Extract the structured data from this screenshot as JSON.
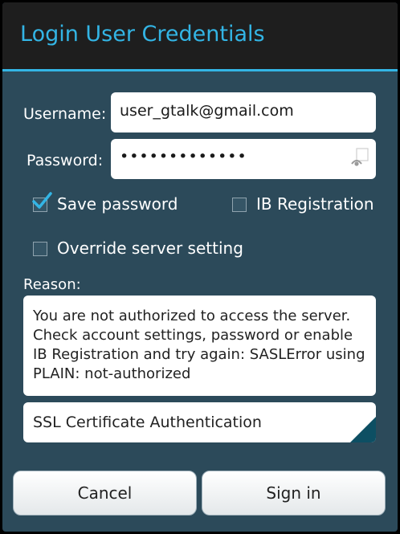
{
  "dialog": {
    "title": "Login User Credentials"
  },
  "form": {
    "username_label": "Username:",
    "username_value": "user_gtalk@gmail.com",
    "password_label": "Password:",
    "password_masked": "•••••••••••••"
  },
  "options": {
    "save_password_label": "Save password",
    "save_password_checked": true,
    "ib_registration_label": "IB Registration",
    "ib_registration_checked": false,
    "override_server_label": "Override server setting",
    "override_server_checked": false
  },
  "reason": {
    "label": "Reason:",
    "text": "You are not authorized to access the server. Check account settings, password or enable IB Registration and try again: SASLError using PLAIN: not-authorized"
  },
  "auth_select": {
    "selected": "SSL Certificate Authentication"
  },
  "buttons": {
    "cancel": "Cancel",
    "sign_in": "Sign in"
  },
  "colors": {
    "accent": "#33b5e5",
    "dialog_bg": "#2c4a5a",
    "title_bg": "#1e1e1e",
    "spinner_corner": "#0d4f63"
  },
  "icons": {
    "check": "check-mark-icon",
    "password_toggle": "eye-icon",
    "dropdown": "dropdown-corner-icon"
  }
}
